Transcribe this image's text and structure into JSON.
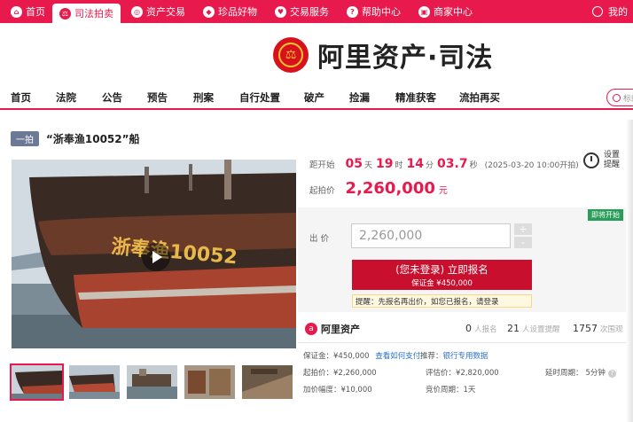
{
  "topnav": {
    "items": [
      {
        "label": "首页",
        "icon": "home-icon"
      },
      {
        "label": "司法拍卖",
        "icon": "auction-icon",
        "active": true
      },
      {
        "label": "资产交易",
        "icon": "compass-icon"
      },
      {
        "label": "珍品好物",
        "icon": "gem-icon"
      },
      {
        "label": "交易服务",
        "icon": "heart-icon"
      },
      {
        "label": "帮助中心",
        "icon": "help-icon"
      },
      {
        "label": "商家中心",
        "icon": "shop-icon"
      }
    ],
    "user_label": "我的"
  },
  "logo": {
    "text": "阿里资产·司法"
  },
  "categories": [
    "首页",
    "法院",
    "公告",
    "预告",
    "刑案",
    "自行处置",
    "破产",
    "捡漏",
    "精准获客",
    "流拍再买"
  ],
  "search": {
    "placeholder": "标的"
  },
  "lot": {
    "badge": "一拍",
    "title": "“浙奉渔10052”船"
  },
  "ship_name": "浙奉渔10052",
  "countdown": {
    "label": "距开始",
    "days": "05",
    "days_unit": "天",
    "hours": "19",
    "hours_unit": "时",
    "minutes": "14",
    "minutes_unit": "分",
    "seconds": "03.7",
    "seconds_unit": "秒",
    "start_time": "(2025-03-20 10:00开拍)"
  },
  "starting_price": {
    "label": "起拍价",
    "value": "2,260,000",
    "unit": "元"
  },
  "remind": {
    "label": "设置提醒"
  },
  "status_tag": "即将开始",
  "bid": {
    "label": "出  价",
    "value": "2,260,000",
    "plus": "+",
    "minus": "-"
  },
  "signup": {
    "line1": "(您未登录) 立即报名",
    "line2": "保证金 ¥450,000"
  },
  "tip": {
    "prefix": "提醒：先报名再出价，如您已报名，",
    "link": "请登录"
  },
  "org": {
    "name": "阿里资产",
    "logo": "a"
  },
  "stats": [
    {
      "value": "0",
      "label": "人报名"
    },
    {
      "value": "21",
      "label": "人设置提醒"
    },
    {
      "value": "1757",
      "label": "次围观"
    }
  ],
  "details": {
    "deposit_label": "保证金：¥450,000",
    "deposit_link": "查看如何支付",
    "recommend_label": "推荐：",
    "recommend_link": "银行专用数据",
    "start_price_label": "起拍价：¥2,260,000",
    "appraisal_label": "评估价：¥2,820,000",
    "delay_label": "延时周期：",
    "delay_value": "5分钟",
    "increment_label": "加价幅度：¥10,000",
    "period_label": "竞价周期：",
    "period_value": "1天"
  },
  "colors": {
    "brand": "#e8194c",
    "signup": "#c8102e",
    "tag": "#2a9d5a"
  }
}
